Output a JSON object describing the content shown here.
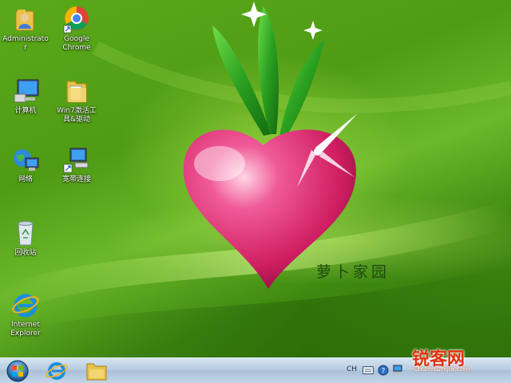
{
  "desktop": {
    "icons": [
      {
        "id": "administrator",
        "label": "Administrato\nr",
        "icon": "user-folder-icon"
      },
      {
        "id": "google-chrome",
        "label": "Google\nChrome",
        "icon": "chrome-icon"
      },
      {
        "id": "computer",
        "label": "计算机",
        "icon": "computer-icon"
      },
      {
        "id": "win7-activator",
        "label": "Win7激活工\n具&驱动",
        "icon": "folder-icon"
      },
      {
        "id": "network",
        "label": "网络",
        "icon": "network-icon"
      },
      {
        "id": "broadband",
        "label": "宽带连接",
        "icon": "broadband-connection-icon"
      },
      {
        "id": "recycle-bin",
        "label": "回收站",
        "icon": "recycle-bin-icon"
      },
      {
        "id": "internet-explorer",
        "label": "Internet\nExplorer",
        "icon": "ie-icon"
      }
    ],
    "wallpaper_text": "萝卜家园"
  },
  "taskbar": {
    "start_icon": "windows-orb-icon",
    "pinned": [
      {
        "id": "ie",
        "icon": "ie-icon"
      },
      {
        "id": "explorer",
        "icon": "folder-icon"
      }
    ],
    "tray": {
      "language": "CH"
    }
  },
  "watermark": {
    "text": "锐客网",
    "url": "Chuiniuzhijia.com"
  },
  "colors": {
    "wallpaper_green": "#4e9c14",
    "heart_pink": "#d8256a",
    "leaf_green": "#2f9a1e",
    "taskbar_blue": "#b9cde0"
  }
}
